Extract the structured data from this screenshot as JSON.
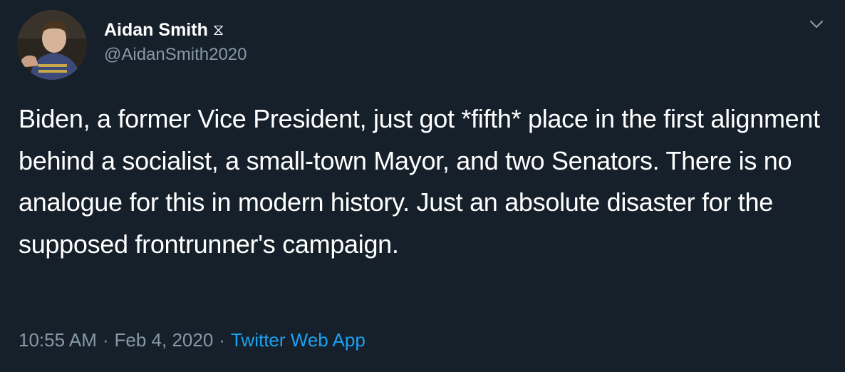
{
  "author": {
    "display_name": "Aidan Smith",
    "name_glyph": "⧖",
    "handle": "@AidanSmith2020"
  },
  "tweet": {
    "text": "Biden, a former Vice President, just got *fifth* place in the first alignment behind a socialist, a small-town Mayor, and two Senators. There is no analogue for this in modern history. Just an absolute disaster for the supposed frontrunner's campaign.",
    "time": "10:55 AM",
    "date": "Feb 4, 2020",
    "separator": "·",
    "source": "Twitter Web App"
  },
  "icons": {
    "menu": "chevron-down-icon",
    "avatar": "profile-photo"
  },
  "colors": {
    "background": "#15202b",
    "secondary_text": "#8899a6",
    "link": "#1da1f2",
    "primary_text": "#ffffff"
  }
}
